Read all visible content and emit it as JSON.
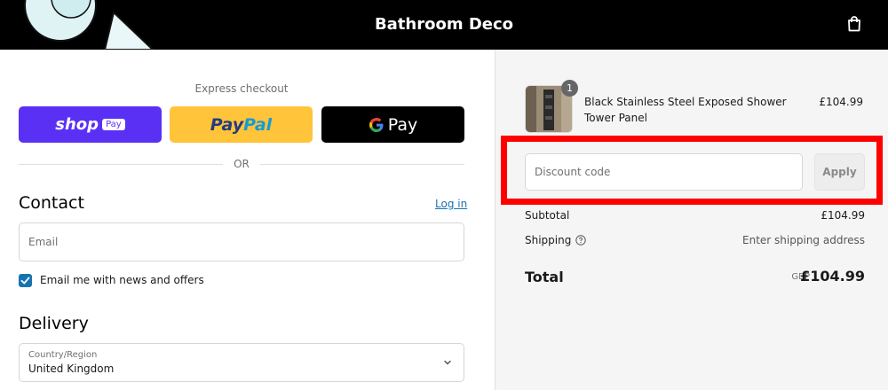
{
  "header": {
    "store_name": "Bathroom Deco",
    "cart_icon": "shopping-bag-icon",
    "background_color": "#000000"
  },
  "express_checkout": {
    "title": "Express checkout",
    "buttons": {
      "shop_pay": {
        "label": "shop",
        "tag": "Pay",
        "color": "#5a31f4"
      },
      "paypal": {
        "label_dark": "Pay",
        "label_light": "Pal",
        "color": "#ffc439"
      },
      "gpay": {
        "g": "G",
        "label": "Pay",
        "color": "#000000"
      }
    },
    "divider_text": "OR"
  },
  "contact": {
    "title": "Contact",
    "login_link": "Log in",
    "email_placeholder": "Email",
    "email_value": "",
    "newsletter_label": "Email me with news and offers",
    "newsletter_checked": true
  },
  "delivery": {
    "title": "Delivery",
    "country_label": "Country/Region",
    "country_value": "United Kingdom"
  },
  "order_summary": {
    "item": {
      "quantity": "1",
      "name": "Black Stainless Steel Exposed Shower Tower Panel",
      "price": "£104.99"
    },
    "discount": {
      "placeholder": "Discount code",
      "apply_label": "Apply"
    },
    "subtotal_label": "Subtotal",
    "subtotal_value": "£104.99",
    "shipping_label": "Shipping",
    "shipping_value": "Enter shipping address",
    "total_label": "Total",
    "total_currency": "GBP",
    "total_value": "£104.99"
  },
  "colors": {
    "accent_link": "#1773b0",
    "highlight_box": "#ff0000",
    "summary_background": "#f5f5f5"
  }
}
